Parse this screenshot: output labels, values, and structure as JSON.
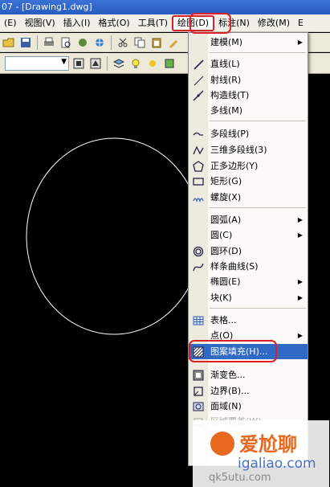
{
  "window": {
    "title": "07 - [Drawing1.dwg]"
  },
  "menubar": {
    "items": [
      {
        "label": "(E)"
      },
      {
        "label": "视图(V)"
      },
      {
        "label": "插入(I)"
      },
      {
        "label": "格式(O)"
      },
      {
        "label": "工具(T)"
      },
      {
        "label": "绘图(D)"
      },
      {
        "label": "标注(N)"
      },
      {
        "label": "修改(M)"
      },
      {
        "label": "E"
      }
    ],
    "active_index": 5
  },
  "draw_menu": {
    "items": [
      {
        "label": "建模(M)",
        "icon": "none",
        "submenu": true
      },
      {
        "label": "直线(L)",
        "icon": "line-icon"
      },
      {
        "label": "射线(R)",
        "icon": "ray-icon"
      },
      {
        "label": "构造线(T)",
        "icon": "construction-line-icon"
      },
      {
        "label": "多线(M)",
        "icon": "none"
      },
      {
        "label": "多段线(P)",
        "icon": "polyline-icon"
      },
      {
        "label": "三维多段线(3)",
        "icon": "3d-polyline-icon"
      },
      {
        "label": "正多边形(Y)",
        "icon": "polygon-icon"
      },
      {
        "label": "矩形(G)",
        "icon": "rectangle-icon"
      },
      {
        "label": "螺旋(X)",
        "icon": "helix-icon"
      },
      {
        "label": "圆弧(A)",
        "icon": "none",
        "submenu": true
      },
      {
        "label": "圆(C)",
        "icon": "none",
        "submenu": true
      },
      {
        "label": "圆环(D)",
        "icon": "donut-icon"
      },
      {
        "label": "样条曲线(S)",
        "icon": "spline-icon"
      },
      {
        "label": "椭圆(E)",
        "icon": "none",
        "submenu": true
      },
      {
        "label": "块(K)",
        "icon": "none",
        "submenu": true
      },
      {
        "label": "表格...",
        "icon": "table-icon"
      },
      {
        "label": "点(O)",
        "icon": "none",
        "submenu": true
      },
      {
        "label": "图案填充(H)...",
        "icon": "hatch-icon",
        "highlighted": true
      },
      {
        "label": "渐变色...",
        "icon": "gradient-icon"
      },
      {
        "label": "边界(B)...",
        "icon": "boundary-icon"
      },
      {
        "label": "面域(N)",
        "icon": "region-icon"
      },
      {
        "label": "区域覆盖(W)",
        "icon": "wipeout-icon",
        "dim": true
      }
    ]
  },
  "watermark": {
    "brand": "爱尬聊",
    "url": "igaliao.com",
    "url2": "qk5utu.com"
  },
  "colors": {
    "highlight": "#316ac5",
    "annotation_red": "#d9212a",
    "canvas": "#000000",
    "circle": "#ffffff"
  }
}
